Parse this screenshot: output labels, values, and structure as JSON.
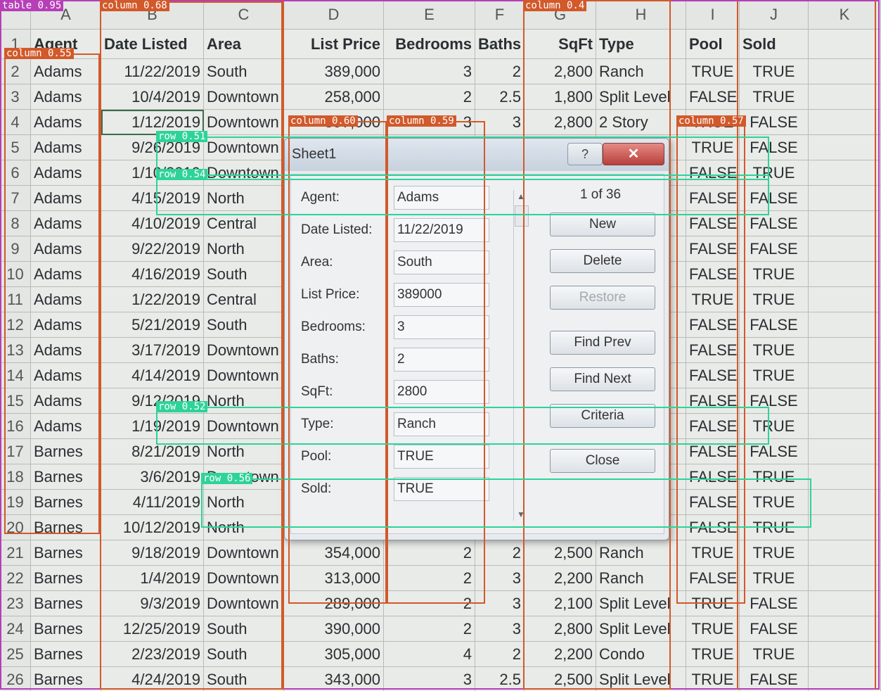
{
  "columns": [
    "A",
    "B",
    "C",
    "D",
    "E",
    "F",
    "G",
    "H",
    "I",
    "J",
    "K"
  ],
  "header": [
    "Agent",
    "Date Listed",
    "Area",
    "List Price",
    "Bedrooms",
    "Baths",
    "SqFt",
    "Type",
    "Pool",
    "Sold",
    ""
  ],
  "rows": [
    {
      "n": "2",
      "cells": [
        "Adams",
        "11/22/2019",
        "South",
        "389,000",
        "3",
        "2",
        "2,800",
        "Ranch",
        "TRUE",
        "TRUE"
      ]
    },
    {
      "n": "3",
      "cells": [
        "Adams",
        "10/4/2019",
        "Downtown",
        "258,000",
        "2",
        "2.5",
        "1,800",
        "Split Level",
        "FALSE",
        "TRUE"
      ]
    },
    {
      "n": "4",
      "cells": [
        "Adams",
        "1/12/2019",
        "Downtown",
        "397,000",
        "3",
        "3",
        "2,800",
        "2 Story",
        "TRUE",
        "FALSE"
      ]
    },
    {
      "n": "5",
      "cells": [
        "Adams",
        "9/26/2019",
        "Downtown",
        "",
        "",
        "",
        "",
        "",
        "TRUE",
        "FALSE"
      ]
    },
    {
      "n": "6",
      "cells": [
        "Adams",
        "1/10/2019",
        "Downtown",
        "",
        "",
        "",
        "",
        "",
        "FALSE",
        "TRUE"
      ]
    },
    {
      "n": "7",
      "cells": [
        "Adams",
        "4/15/2019",
        "North",
        "",
        "",
        "",
        "",
        "",
        "FALSE",
        "FALSE"
      ]
    },
    {
      "n": "8",
      "cells": [
        "Adams",
        "4/10/2019",
        "Central",
        "",
        "",
        "",
        "",
        "",
        "FALSE",
        "FALSE"
      ]
    },
    {
      "n": "9",
      "cells": [
        "Adams",
        "9/22/2019",
        "North",
        "",
        "",
        "",
        "",
        "",
        "FALSE",
        "FALSE"
      ]
    },
    {
      "n": "10",
      "cells": [
        "Adams",
        "4/16/2019",
        "South",
        "",
        "",
        "",
        "",
        "",
        "FALSE",
        "TRUE"
      ]
    },
    {
      "n": "11",
      "cells": [
        "Adams",
        "1/22/2019",
        "Central",
        "",
        "",
        "",
        "",
        "",
        "TRUE",
        "TRUE"
      ]
    },
    {
      "n": "12",
      "cells": [
        "Adams",
        "5/21/2019",
        "South",
        "",
        "",
        "",
        "",
        "",
        "FALSE",
        "FALSE"
      ]
    },
    {
      "n": "13",
      "cells": [
        "Adams",
        "3/17/2019",
        "Downtown",
        "",
        "",
        "",
        "",
        "",
        "FALSE",
        "TRUE"
      ]
    },
    {
      "n": "14",
      "cells": [
        "Adams",
        "4/14/2019",
        "Downtown",
        "",
        "",
        "",
        "",
        "l",
        "FALSE",
        "TRUE"
      ]
    },
    {
      "n": "15",
      "cells": [
        "Adams",
        "9/12/2019",
        "North",
        "",
        "",
        "",
        "",
        "",
        "FALSE",
        "FALSE"
      ]
    },
    {
      "n": "16",
      "cells": [
        "Adams",
        "1/19/2019",
        "Downtown",
        "",
        "",
        "",
        "",
        "",
        "FALSE",
        "TRUE"
      ]
    },
    {
      "n": "17",
      "cells": [
        "Barnes",
        "8/21/2019",
        "North",
        "",
        "",
        "",
        "",
        "",
        "FALSE",
        "FALSE"
      ]
    },
    {
      "n": "18",
      "cells": [
        "Barnes",
        "3/6/2019",
        "Downtown",
        "",
        "",
        "",
        "",
        "",
        "FALSE",
        "TRUE"
      ]
    },
    {
      "n": "19",
      "cells": [
        "Barnes",
        "4/11/2019",
        "North",
        "",
        "",
        "",
        "",
        "",
        "FALSE",
        "TRUE"
      ]
    },
    {
      "n": "20",
      "cells": [
        "Barnes",
        "10/12/2019",
        "North",
        "",
        "",
        "",
        "",
        "",
        "FALSE",
        "TRUE"
      ]
    },
    {
      "n": "21",
      "cells": [
        "Barnes",
        "9/18/2019",
        "Downtown",
        "354,000",
        "2",
        "2",
        "2,500",
        "Ranch",
        "TRUE",
        "TRUE"
      ]
    },
    {
      "n": "22",
      "cells": [
        "Barnes",
        "1/4/2019",
        "Downtown",
        "313,000",
        "2",
        "3",
        "2,200",
        "Ranch",
        "FALSE",
        "TRUE"
      ]
    },
    {
      "n": "23",
      "cells": [
        "Barnes",
        "9/3/2019",
        "Downtown",
        "289,000",
        "2",
        "3",
        "2,100",
        "Split Level",
        "TRUE",
        "FALSE"
      ]
    },
    {
      "n": "24",
      "cells": [
        "Barnes",
        "12/25/2019",
        "South",
        "390,000",
        "2",
        "3",
        "2,800",
        "Split Level",
        "TRUE",
        "FALSE"
      ]
    },
    {
      "n": "25",
      "cells": [
        "Barnes",
        "2/23/2019",
        "South",
        "305,000",
        "4",
        "2",
        "2,200",
        "Condo",
        "TRUE",
        "TRUE"
      ]
    },
    {
      "n": "26",
      "cells": [
        "Barnes",
        "4/24/2019",
        "South",
        "343,000",
        "3",
        "2.5",
        "2,500",
        "Split Level",
        "TRUE",
        "FALSE"
      ]
    }
  ],
  "header_row_number": "1",
  "dialog": {
    "title": "Sheet1",
    "help_glyph": "?",
    "close_glyph": "✕",
    "record_counter": "1 of 36",
    "fields": [
      {
        "label": "Agent:",
        "value": "Adams"
      },
      {
        "label": "Date Listed:",
        "value": "11/22/2019"
      },
      {
        "label": "Area:",
        "value": "South"
      },
      {
        "label": "List Price:",
        "value": "389000"
      },
      {
        "label": "Bedrooms:",
        "value": "3"
      },
      {
        "label": "Baths:",
        "value": "2"
      },
      {
        "label": "SqFt:",
        "value": "2800"
      },
      {
        "label": "Type:",
        "value": "Ranch"
      },
      {
        "label": "Pool:",
        "value": "TRUE"
      },
      {
        "label": "Sold:",
        "value": "TRUE"
      }
    ],
    "buttons": [
      {
        "label": "New",
        "enabled": true
      },
      {
        "label": "Delete",
        "enabled": true
      },
      {
        "label": "Restore",
        "enabled": false
      },
      {
        "label": "Find Prev",
        "enabled": true
      },
      {
        "label": "Find Next",
        "enabled": true
      },
      {
        "label": "Criteria",
        "enabled": true
      },
      {
        "label": "Close",
        "enabled": true
      }
    ],
    "scroll_up_glyph": "▲",
    "scroll_down_glyph": "▼"
  },
  "overlays": {
    "colors": {
      "column": "#d2592a",
      "row": "#2ed39a",
      "table": "#b63fb8"
    },
    "labels": [
      "table 0.95",
      "column 0.55",
      "column 0.68",
      "column 0.60",
      "column 0.59",
      "column 0.57",
      "column 0.4",
      "row 0.51",
      "row 0.54",
      "row 0.52",
      "row 0.56"
    ]
  }
}
